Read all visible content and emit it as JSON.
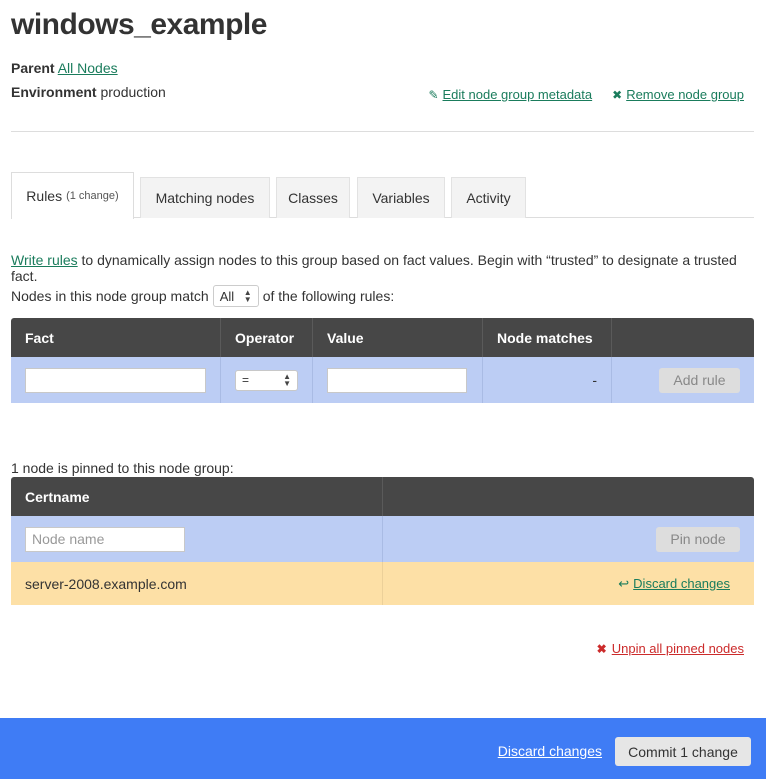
{
  "page": {
    "title": "windows_example",
    "parent_label": "Parent",
    "parent_value": "All Nodes",
    "environment_label": "Environment",
    "environment_value": "production"
  },
  "actions": {
    "edit_icon": "pencil-icon",
    "edit_label": "Edit node group metadata",
    "remove_icon": "x-icon",
    "remove_label": "Remove node group"
  },
  "tabs": [
    {
      "label": "Rules",
      "badge": "(1 change)",
      "active": true
    },
    {
      "label": "Matching nodes",
      "badge": ""
    },
    {
      "label": "Classes",
      "badge": ""
    },
    {
      "label": "Variables",
      "badge": ""
    },
    {
      "label": "Activity",
      "badge": ""
    }
  ],
  "rules": {
    "write_rules_link": "Write rules",
    "description": " to dynamically assign nodes to this group based on fact values. Begin with “trusted” to designate a trusted fact.",
    "match_prefix": "Nodes in this node group match",
    "match_value": "All",
    "match_suffix": "of the following rules:",
    "headers": {
      "fact": "Fact",
      "operator": "Operator",
      "value": "Value",
      "node_matches": "Node matches"
    },
    "new_rule": {
      "fact": "",
      "operator": "=",
      "value": "",
      "node_matches": "-"
    },
    "add_rule_button": "Add rule"
  },
  "pinned": {
    "summary": "1 node is pinned to this node group:",
    "header_certname": "Certname",
    "node_name_placeholder": "Node name",
    "pin_button": "Pin node",
    "rows": [
      {
        "certname": "server-2008.example.com",
        "action": "Discard changes",
        "action_icon": "undo-arrow-icon"
      }
    ],
    "unpin_all": "Unpin all pinned nodes",
    "unpin_icon": "x-icon"
  },
  "footer": {
    "discard_label": "Discard changes",
    "commit_label": "Commit 1 change",
    "background": "#3f7cf5"
  }
}
